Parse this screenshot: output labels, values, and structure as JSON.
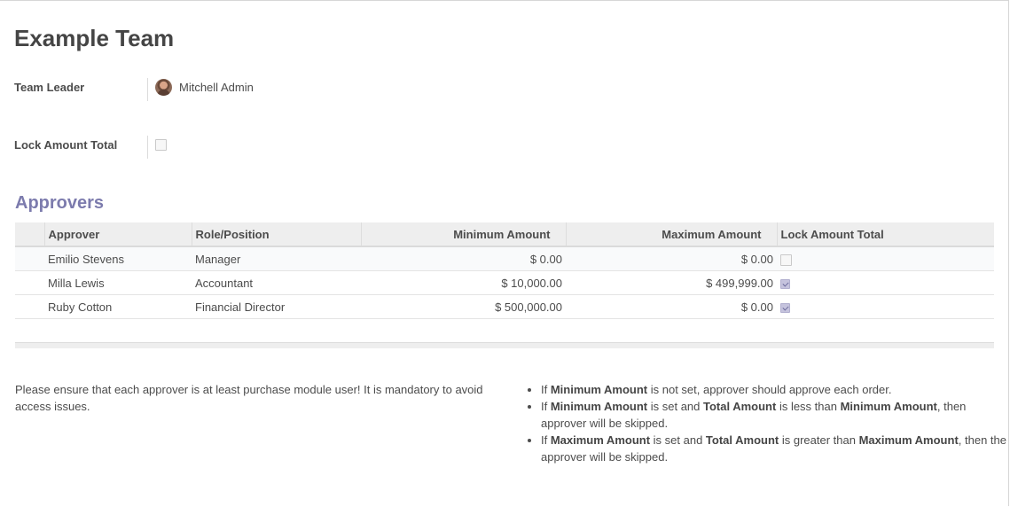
{
  "record": {
    "title": "Example Team"
  },
  "fields": {
    "team_leader_label": "Team Leader",
    "team_leader_value": "Mitchell Admin",
    "lock_amount_label": "Lock Amount Total",
    "lock_amount_checked": false
  },
  "approvers": {
    "section_title": "Approvers",
    "columns": [
      "Approver",
      "Role/Position",
      "Minimum Amount",
      "Maximum Amount",
      "Lock Amount Total"
    ],
    "rows": [
      {
        "approver": "Emilio Stevens",
        "role": "Manager",
        "min": "$ 0.00",
        "max": "$ 0.00",
        "lock": false
      },
      {
        "approver": "Milla Lewis",
        "role": "Accountant",
        "min": "$ 10,000.00",
        "max": "$ 499,999.00",
        "lock": true
      },
      {
        "approver": "Ruby Cotton",
        "role": "Financial Director",
        "min": "$ 500,000.00",
        "max": "$ 0.00",
        "lock": true
      }
    ]
  },
  "notes": {
    "info": "Please ensure that each approver is at least purchase module user! It is mandatory to avoid access issues.",
    "rule1": {
      "a": "If ",
      "b": "Minimum Amount",
      "c": " is not set, approver should approve each order."
    },
    "rule2": {
      "a": "If ",
      "b": "Minimum Amount",
      "c": " is set and ",
      "d": "Total Amount",
      "e": " is less than ",
      "f": "Minimum Amount",
      "g": ", then approver will be skipped."
    },
    "rule3": {
      "a": "If ",
      "b": "Maximum Amount",
      "c": " is set and ",
      "d": "Total Amount",
      "e": " is greater than ",
      "f": "Maximum Amount",
      "g": ", then the approver will be skipped."
    }
  },
  "colors": {
    "accent": "#7c7bad",
    "checkbox_checked": "#c5c3dd"
  },
  "icons": {
    "avatar": "user-avatar",
    "checkbox_checked": "checkmark-icon"
  }
}
